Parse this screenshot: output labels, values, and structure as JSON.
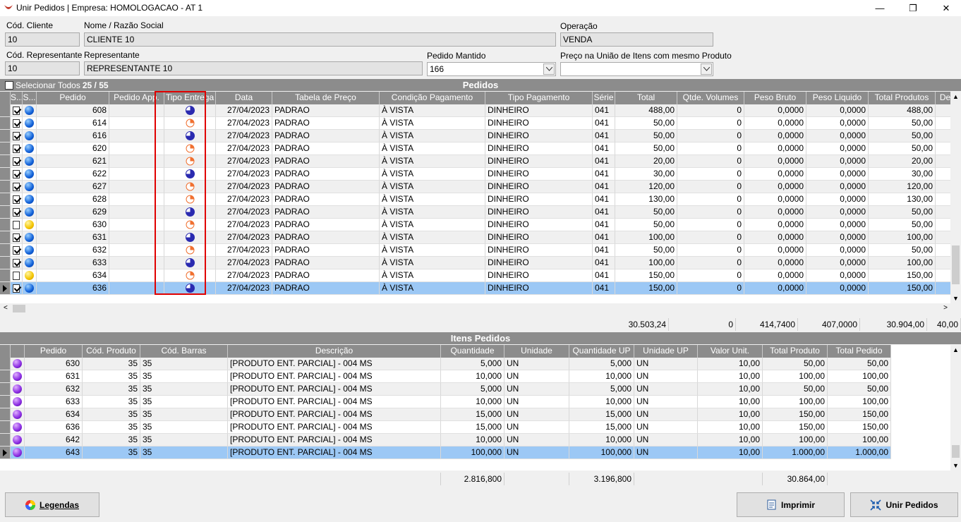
{
  "window": {
    "title": "Unir Pedidos | Empresa: HOMOLOGACAO - AT 1",
    "minimize": "—",
    "maximize": "❐",
    "close": "✕"
  },
  "form": {
    "cod_cliente_label": "Cód. Cliente",
    "cod_cliente_value": "10",
    "nome_label": "Nome / Razão Social",
    "nome_value": "CLIENTE 10",
    "operacao_label": "Operação",
    "operacao_value": "VENDA",
    "cod_rep_label": "Cód. Representante",
    "cod_rep_value": "10",
    "rep_label": "Representante",
    "rep_value": "REPRESENTANTE 10",
    "pedido_mantido_label": "Pedido Mantido",
    "pedido_mantido_value": "166",
    "preco_label": "Preço na União de Itens com mesmo Produto",
    "preco_value": ""
  },
  "pedidos": {
    "band_title": "Pedidos",
    "select_all_label": "Selecionar Todos",
    "count": "25 / 55",
    "columns": [
      "S...",
      "S...",
      "Pedido",
      "Pedido App.",
      "Tipo Entrega",
      "Data",
      "Tabela de Preço",
      "Condição Pagamento",
      "Tipo Pagamento",
      "Série",
      "Total",
      "Qtde. Volumes",
      "Peso Bruto",
      "Peso Liquido",
      "Total Produtos",
      "Desc"
    ],
    "rows": [
      {
        "checked": true,
        "status": "blue",
        "pedido": "608",
        "app": "",
        "entrega": "full",
        "data": "27/04/2023",
        "tabela": "PADRAO",
        "cond": "À VISTA",
        "tipo": "DINHEIRO",
        "serie": "041",
        "total": "488,00",
        "vol": "0",
        "bruto": "0,0000",
        "liq": "0,0000",
        "prod": "488,00"
      },
      {
        "checked": true,
        "status": "blue",
        "pedido": "614",
        "app": "",
        "entrega": "partial",
        "data": "27/04/2023",
        "tabela": "PADRAO",
        "cond": "À VISTA",
        "tipo": "DINHEIRO",
        "serie": "041",
        "total": "50,00",
        "vol": "0",
        "bruto": "0,0000",
        "liq": "0,0000",
        "prod": "50,00"
      },
      {
        "checked": true,
        "status": "blue",
        "pedido": "616",
        "app": "",
        "entrega": "full",
        "data": "27/04/2023",
        "tabela": "PADRAO",
        "cond": "À VISTA",
        "tipo": "DINHEIRO",
        "serie": "041",
        "total": "50,00",
        "vol": "0",
        "bruto": "0,0000",
        "liq": "0,0000",
        "prod": "50,00"
      },
      {
        "checked": true,
        "status": "blue",
        "pedido": "620",
        "app": "",
        "entrega": "partial",
        "data": "27/04/2023",
        "tabela": "PADRAO",
        "cond": "À VISTA",
        "tipo": "DINHEIRO",
        "serie": "041",
        "total": "50,00",
        "vol": "0",
        "bruto": "0,0000",
        "liq": "0,0000",
        "prod": "50,00"
      },
      {
        "checked": true,
        "status": "blue",
        "pedido": "621",
        "app": "",
        "entrega": "partial",
        "data": "27/04/2023",
        "tabela": "PADRAO",
        "cond": "À VISTA",
        "tipo": "DINHEIRO",
        "serie": "041",
        "total": "20,00",
        "vol": "0",
        "bruto": "0,0000",
        "liq": "0,0000",
        "prod": "20,00"
      },
      {
        "checked": true,
        "status": "blue",
        "pedido": "622",
        "app": "",
        "entrega": "full",
        "data": "27/04/2023",
        "tabela": "PADRAO",
        "cond": "À VISTA",
        "tipo": "DINHEIRO",
        "serie": "041",
        "total": "30,00",
        "vol": "0",
        "bruto": "0,0000",
        "liq": "0,0000",
        "prod": "30,00"
      },
      {
        "checked": true,
        "status": "blue",
        "pedido": "627",
        "app": "",
        "entrega": "partial",
        "data": "27/04/2023",
        "tabela": "PADRAO",
        "cond": "À VISTA",
        "tipo": "DINHEIRO",
        "serie": "041",
        "total": "120,00",
        "vol": "0",
        "bruto": "0,0000",
        "liq": "0,0000",
        "prod": "120,00"
      },
      {
        "checked": true,
        "status": "blue",
        "pedido": "628",
        "app": "",
        "entrega": "partial",
        "data": "27/04/2023",
        "tabela": "PADRAO",
        "cond": "À VISTA",
        "tipo": "DINHEIRO",
        "serie": "041",
        "total": "130,00",
        "vol": "0",
        "bruto": "0,0000",
        "liq": "0,0000",
        "prod": "130,00"
      },
      {
        "checked": true,
        "status": "blue",
        "pedido": "629",
        "app": "",
        "entrega": "full",
        "data": "27/04/2023",
        "tabela": "PADRAO",
        "cond": "À VISTA",
        "tipo": "DINHEIRO",
        "serie": "041",
        "total": "50,00",
        "vol": "0",
        "bruto": "0,0000",
        "liq": "0,0000",
        "prod": "50,00"
      },
      {
        "checked": false,
        "status": "yellow",
        "pedido": "630",
        "app": "",
        "entrega": "partial",
        "data": "27/04/2023",
        "tabela": "PADRAO",
        "cond": "À VISTA",
        "tipo": "DINHEIRO",
        "serie": "041",
        "total": "50,00",
        "vol": "0",
        "bruto": "0,0000",
        "liq": "0,0000",
        "prod": "50,00"
      },
      {
        "checked": true,
        "status": "blue",
        "pedido": "631",
        "app": "",
        "entrega": "full",
        "data": "27/04/2023",
        "tabela": "PADRAO",
        "cond": "À VISTA",
        "tipo": "DINHEIRO",
        "serie": "041",
        "total": "100,00",
        "vol": "0",
        "bruto": "0,0000",
        "liq": "0,0000",
        "prod": "100,00"
      },
      {
        "checked": true,
        "status": "blue",
        "pedido": "632",
        "app": "",
        "entrega": "partial",
        "data": "27/04/2023",
        "tabela": "PADRAO",
        "cond": "À VISTA",
        "tipo": "DINHEIRO",
        "serie": "041",
        "total": "50,00",
        "vol": "0",
        "bruto": "0,0000",
        "liq": "0,0000",
        "prod": "50,00"
      },
      {
        "checked": true,
        "status": "blue",
        "pedido": "633",
        "app": "",
        "entrega": "full",
        "data": "27/04/2023",
        "tabela": "PADRAO",
        "cond": "À VISTA",
        "tipo": "DINHEIRO",
        "serie": "041",
        "total": "100,00",
        "vol": "0",
        "bruto": "0,0000",
        "liq": "0,0000",
        "prod": "100,00"
      },
      {
        "checked": false,
        "status": "yellow",
        "pedido": "634",
        "app": "",
        "entrega": "partial",
        "data": "27/04/2023",
        "tabela": "PADRAO",
        "cond": "À VISTA",
        "tipo": "DINHEIRO",
        "serie": "041",
        "total": "150,00",
        "vol": "0",
        "bruto": "0,0000",
        "liq": "0,0000",
        "prod": "150,00"
      },
      {
        "checked": true,
        "status": "blue",
        "pedido": "636",
        "app": "",
        "entrega": "full",
        "data": "27/04/2023",
        "tabela": "PADRAO",
        "cond": "À VISTA",
        "tipo": "DINHEIRO",
        "serie": "041",
        "total": "150,00",
        "vol": "0",
        "bruto": "0,0000",
        "liq": "0,0000",
        "prod": "150,00",
        "selected": true
      }
    ],
    "totals": {
      "total": "30.503,24",
      "vol": "0",
      "bruto": "414,7400",
      "liq": "407,0000",
      "prod": "30.904,00",
      "desc": "40,00"
    }
  },
  "itens": {
    "band_title": "Itens Pedidos",
    "columns": [
      "",
      "Pedido",
      "Cód. Produto",
      "Cód. Barras",
      "Descrição",
      "Quantidade",
      "Unidade",
      "Quantidade UP",
      "Unidade UP",
      "Valor Unit.",
      "Total Produto",
      "Total Pedido"
    ],
    "rows": [
      {
        "pedido": "630",
        "cod": "35",
        "barras": "35",
        "desc": "[PRODUTO ENT. PARCIAL] - 004 MS",
        "qtd": "5,000",
        "un": "UN",
        "qup": "5,000",
        "unup": "UN",
        "vu": "10,00",
        "tp": "50,00",
        "tped": "50,00"
      },
      {
        "pedido": "631",
        "cod": "35",
        "barras": "35",
        "desc": "[PRODUTO ENT. PARCIAL] - 004 MS",
        "qtd": "10,000",
        "un": "UN",
        "qup": "10,000",
        "unup": "UN",
        "vu": "10,00",
        "tp": "100,00",
        "tped": "100,00"
      },
      {
        "pedido": "632",
        "cod": "35",
        "barras": "35",
        "desc": "[PRODUTO ENT. PARCIAL] - 004 MS",
        "qtd": "5,000",
        "un": "UN",
        "qup": "5,000",
        "unup": "UN",
        "vu": "10,00",
        "tp": "50,00",
        "tped": "50,00"
      },
      {
        "pedido": "633",
        "cod": "35",
        "barras": "35",
        "desc": "[PRODUTO ENT. PARCIAL] - 004 MS",
        "qtd": "10,000",
        "un": "UN",
        "qup": "10,000",
        "unup": "UN",
        "vu": "10,00",
        "tp": "100,00",
        "tped": "100,00"
      },
      {
        "pedido": "634",
        "cod": "35",
        "barras": "35",
        "desc": "[PRODUTO ENT. PARCIAL] - 004 MS",
        "qtd": "15,000",
        "un": "UN",
        "qup": "15,000",
        "unup": "UN",
        "vu": "10,00",
        "tp": "150,00",
        "tped": "150,00"
      },
      {
        "pedido": "636",
        "cod": "35",
        "barras": "35",
        "desc": "[PRODUTO ENT. PARCIAL] - 004 MS",
        "qtd": "15,000",
        "un": "UN",
        "qup": "15,000",
        "unup": "UN",
        "vu": "10,00",
        "tp": "150,00",
        "tped": "150,00"
      },
      {
        "pedido": "642",
        "cod": "35",
        "barras": "35",
        "desc": "[PRODUTO ENT. PARCIAL] - 004 MS",
        "qtd": "10,000",
        "un": "UN",
        "qup": "10,000",
        "unup": "UN",
        "vu": "10,00",
        "tp": "100,00",
        "tped": "100,00"
      },
      {
        "pedido": "643",
        "cod": "35",
        "barras": "35",
        "desc": "[PRODUTO ENT. PARCIAL] - 004 MS",
        "qtd": "100,000",
        "un": "UN",
        "qup": "100,000",
        "unup": "UN",
        "vu": "10,00",
        "tp": "1.000,00",
        "tped": "1.000,00",
        "selected": true
      }
    ],
    "totals": {
      "qtd": "2.816,800",
      "qup": "3.196,800",
      "tp": "30.864,00"
    }
  },
  "buttons": {
    "legendas": "Legendas",
    "imprimir": "Imprimir",
    "unir": "Unir Pedidos"
  },
  "colors": {
    "header_gray": "#8c8c8c",
    "selected_row": "#9cc8f5",
    "highlight_box": "#e00000"
  }
}
